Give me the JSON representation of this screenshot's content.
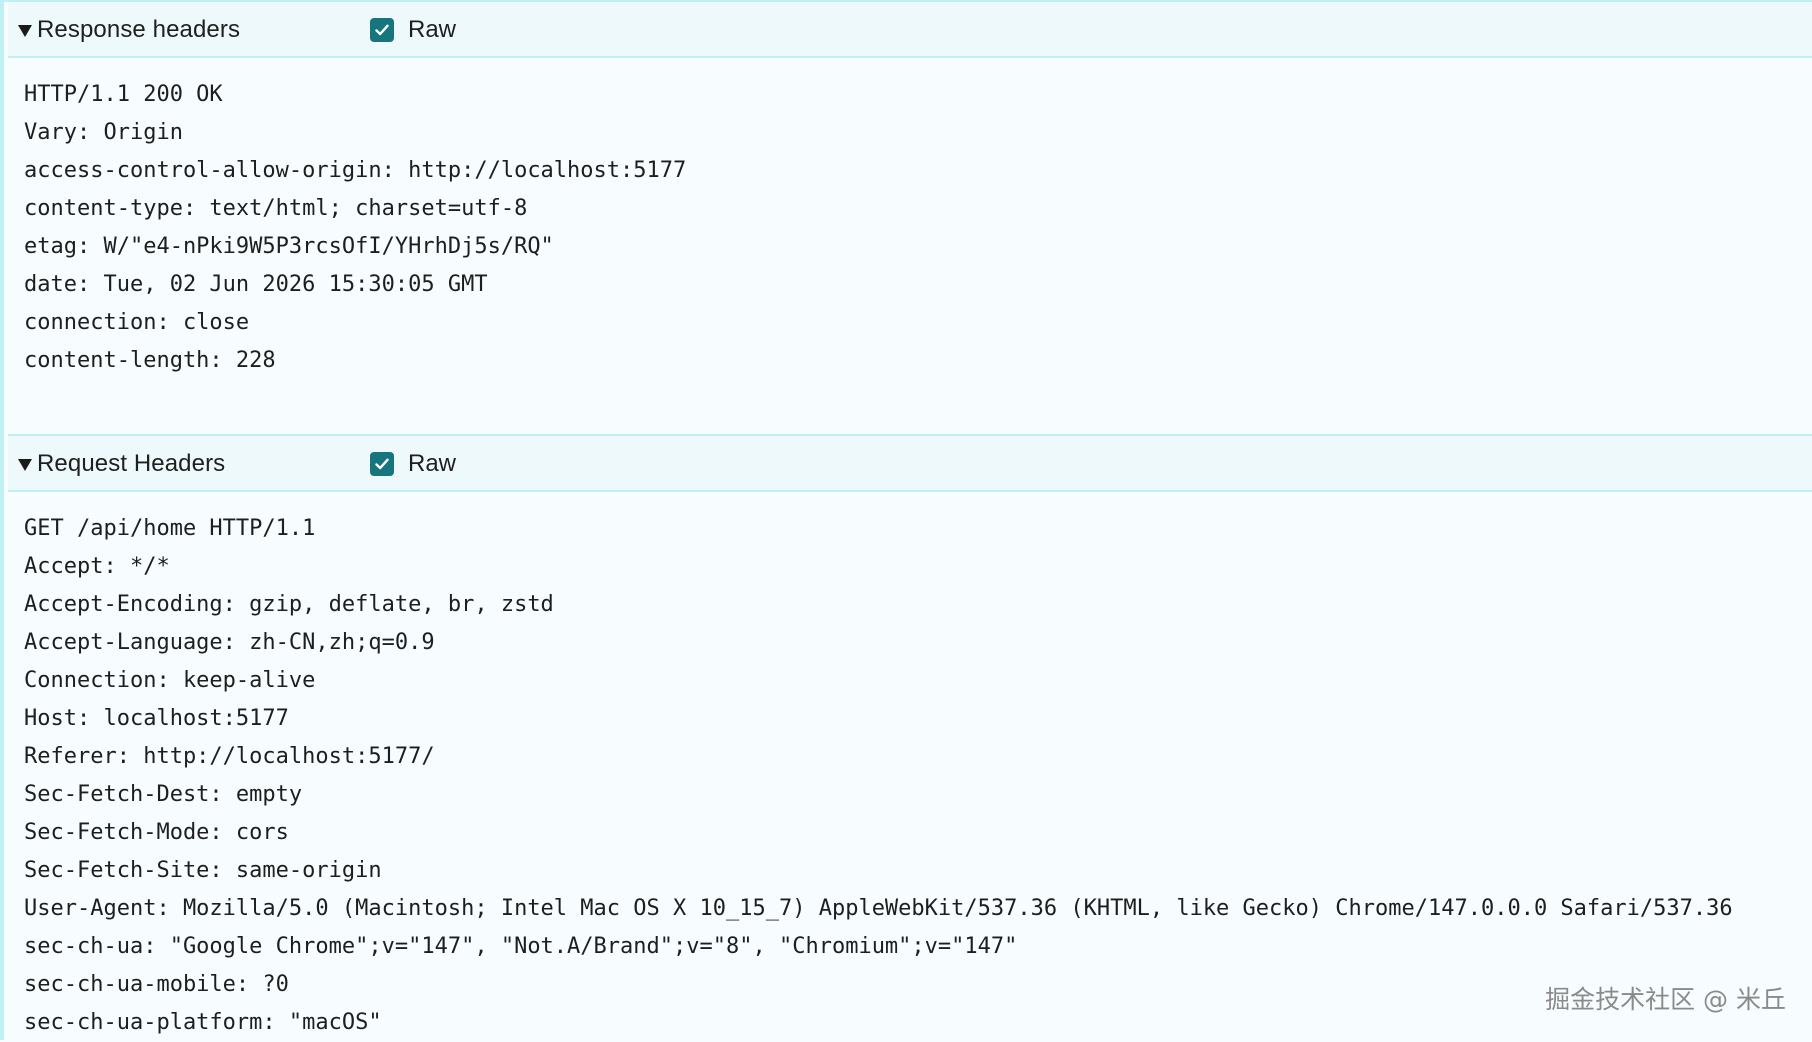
{
  "response_section": {
    "title": "Response headers",
    "raw_label": "Raw",
    "lines": [
      "HTTP/1.1 200 OK",
      "Vary: Origin",
      "access-control-allow-origin: http://localhost:5177",
      "content-type: text/html; charset=utf-8",
      "etag: W/\"e4-nPki9W5P3rcsOfI/YHrhDj5s/RQ\"",
      "date: Tue, 02 Jun 2026 15:30:05 GMT",
      "connection: close",
      "content-length: 228"
    ]
  },
  "request_section": {
    "title": "Request Headers",
    "raw_label": "Raw",
    "lines": [
      "GET /api/home HTTP/1.1",
      "Accept: */*",
      "Accept-Encoding: gzip, deflate, br, zstd",
      "Accept-Language: zh-CN,zh;q=0.9",
      "Connection: keep-alive",
      "Host: localhost:5177",
      "Referer: http://localhost:5177/",
      "Sec-Fetch-Dest: empty",
      "Sec-Fetch-Mode: cors",
      "Sec-Fetch-Site: same-origin",
      "User-Agent: Mozilla/5.0 (Macintosh; Intel Mac OS X 10_15_7) AppleWebKit/537.36 (KHTML, like Gecko) Chrome/147.0.0.0 Safari/537.36",
      "sec-ch-ua: \"Google Chrome\";v=\"147\", \"Not.A/Brand\";v=\"8\", \"Chromium\";v=\"147\"",
      "sec-ch-ua-mobile: ?0",
      "sec-ch-ua-platform: \"macOS\""
    ]
  },
  "watermark": "掘金技术社区 @ 米丘",
  "colors": {
    "checkbox": "#16757d",
    "highlight": "#fcd6e3",
    "border": "#bff0f6"
  },
  "icons": {
    "collapse": "triangle-down-icon",
    "check": "checkmark-icon"
  }
}
